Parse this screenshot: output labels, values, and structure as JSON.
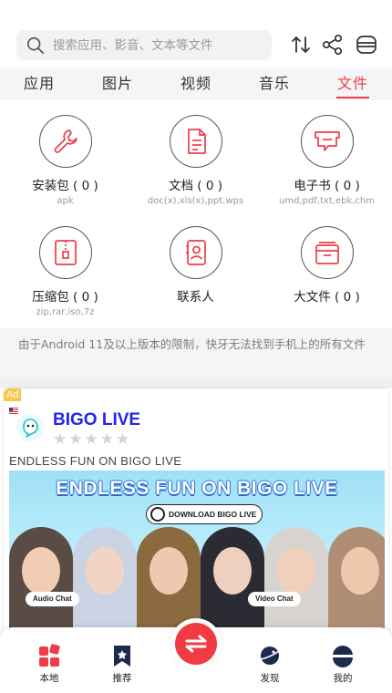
{
  "search": {
    "placeholder": "搜索应用、影音、文本等文件"
  },
  "header_icons": [
    "sort-icon",
    "share-icon",
    "menu-icon"
  ],
  "tabs": [
    {
      "label": "应用",
      "active": false
    },
    {
      "label": "图片",
      "active": false
    },
    {
      "label": "视频",
      "active": false
    },
    {
      "label": "音乐",
      "active": false
    },
    {
      "label": "文件",
      "active": true
    }
  ],
  "accent_color": "#ee3d46",
  "categories": [
    {
      "title": "安装包 ( 0 )",
      "subtitle": "apk",
      "icon": "wrench-icon"
    },
    {
      "title": "文档 ( 0 )",
      "subtitle": "doc(x),xls(x),ppt,wps",
      "icon": "document-icon"
    },
    {
      "title": "电子书 ( 0 )",
      "subtitle": "umd,pdf,txt,ebk,chm",
      "icon": "ebook-icon"
    },
    {
      "title": "压缩包 ( 0 )",
      "subtitle": "zip,rar,iso,7z",
      "icon": "archive-icon"
    },
    {
      "title": "联系人",
      "subtitle": "",
      "icon": "contacts-icon"
    },
    {
      "title": "大文件 ( 0 )",
      "subtitle": "",
      "icon": "large-file-icon"
    }
  ],
  "notice": "由于Android 11及以上版本的限制，快牙无法找到手机上的所有文件",
  "ad": {
    "tag": "Ad",
    "app_name": "BIGO LIVE",
    "rating": 0,
    "description": "ENDLESS FUN ON BIGO LIVE",
    "banner_headline": "ENDLESS FUN ON BIGO LIVE",
    "banner_button": "DOWNLOAD BIGO LIVE",
    "bubble_left": "Audio Chat",
    "bubble_right": "Video Chat"
  },
  "bottom_nav": [
    {
      "label": "本地",
      "icon": "grid-icon"
    },
    {
      "label": "推荐",
      "icon": "bookmark-star-icon"
    },
    {
      "label": "发现",
      "icon": "planet-icon"
    },
    {
      "label": "我的",
      "icon": "profile-icon"
    }
  ],
  "fab": {
    "icon": "transfer-icon"
  }
}
